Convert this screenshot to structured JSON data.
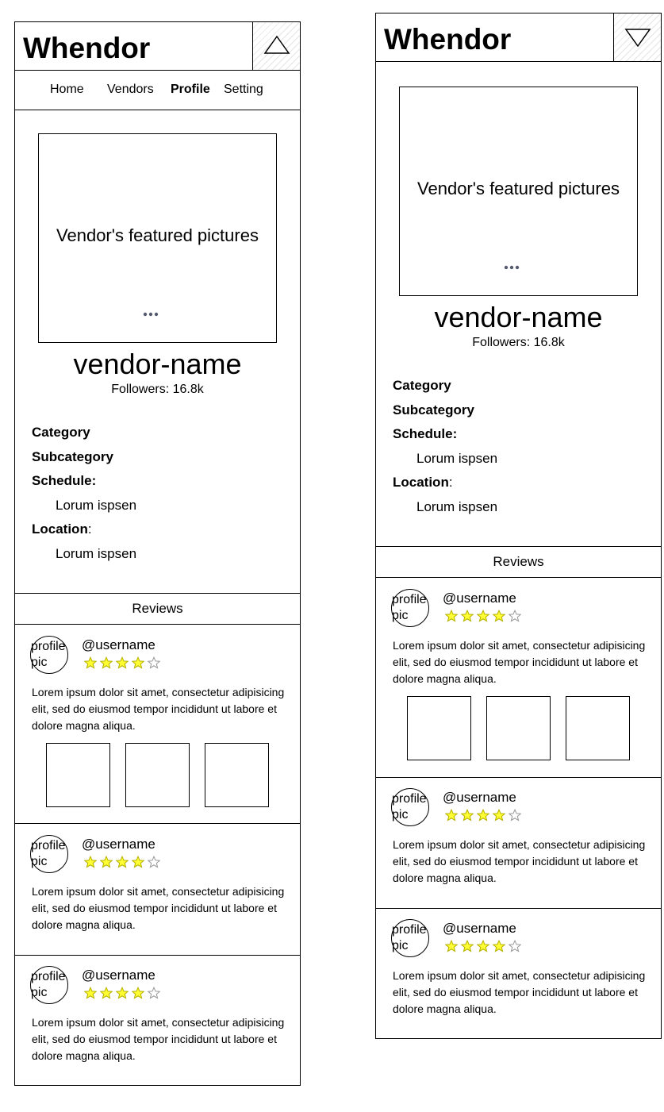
{
  "colors": {
    "border": "#000000",
    "star_filled": "#ffff33",
    "star_empty": "#ffffff",
    "dots": "#555b6e",
    "hatch": "#e4e4e4"
  },
  "icons": {
    "menu_open": "triangle-up-icon",
    "menu_closed": "triangle-down-icon",
    "star": "star-icon",
    "more": "ellipsis-icon"
  },
  "app": {
    "title": "Whendor"
  },
  "nav": {
    "items": [
      {
        "label": "Home"
      },
      {
        "label": "Vendors"
      },
      {
        "label": "Profile"
      },
      {
        "label": "Setting"
      }
    ],
    "active": "Profile"
  },
  "vendor": {
    "featured_text": "Vendor's featured pictures",
    "name": "vendor-name",
    "followers_label": "Followers:",
    "followers_value": "16.8k",
    "category_label": "Category",
    "subcategory_label": "Subcategory",
    "schedule_label": "Schedule:",
    "schedule_value": "Lorum ispsen",
    "location_label": "Location",
    "location_colon": ":",
    "location_value": "Lorum ispsen"
  },
  "reviews": {
    "title": "Reviews",
    "items": [
      {
        "avatar": "profile pic",
        "username": "@username",
        "rating": 4,
        "max_rating": 5,
        "text": "Lorem ipsum dolor sit amet, consectetur adipisicing elit, sed do eiusmod tempor incididunt ut labore et dolore magna aliqua.",
        "photo_count": 3
      },
      {
        "avatar": "profile pic",
        "username": "@username",
        "rating": 4,
        "max_rating": 5,
        "text": "Lorem ipsum dolor sit amet, consectetur adipisicing elit, sed do eiusmod tempor incididunt ut labore et dolore magna aliqua.",
        "photo_count": 0
      },
      {
        "avatar": "profile pic",
        "username": "@username",
        "rating": 4,
        "max_rating": 5,
        "text": "Lorem ipsum dolor sit amet, consectetur adipisicing elit, sed do eiusmod tempor incididunt ut labore et dolore magna aliqua.",
        "photo_count": 0
      }
    ]
  }
}
